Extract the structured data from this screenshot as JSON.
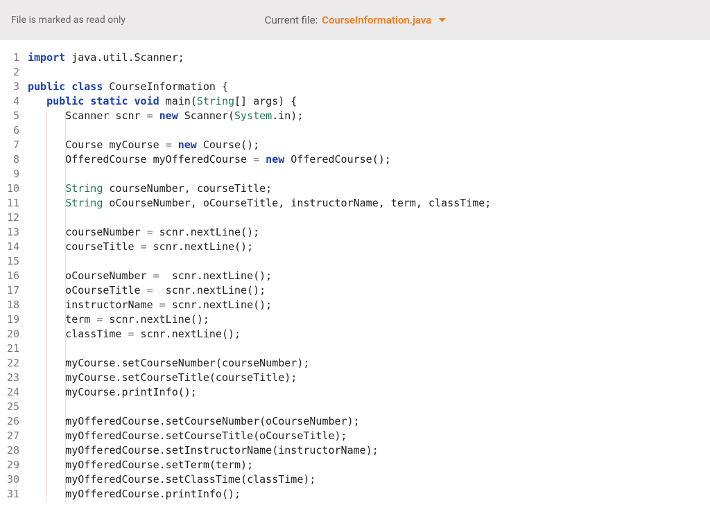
{
  "header": {
    "readonly_message": "File is marked as read only",
    "current_file_label": "Current file:",
    "current_file_name": "CourseInformation.java"
  },
  "editor": {
    "line_count": 31,
    "lines": [
      {
        "n": 1,
        "guides": [],
        "tokens": [
          [
            "kw",
            "import"
          ],
          [
            "txt",
            " java.util.Scanner;"
          ]
        ]
      },
      {
        "n": 2,
        "guides": [],
        "tokens": []
      },
      {
        "n": 3,
        "guides": [],
        "tokens": [
          [
            "kw",
            "public class"
          ],
          [
            "txt",
            " CourseInformation {"
          ]
        ]
      },
      {
        "n": 4,
        "guides": [],
        "tokens": [
          [
            "txt",
            "   "
          ],
          [
            "kw",
            "public static void"
          ],
          [
            "txt",
            " main("
          ],
          [
            "type",
            "String"
          ],
          [
            "txt",
            "[] args) {"
          ]
        ]
      },
      {
        "n": 5,
        "guides": [
          3,
          6
        ],
        "tokens": [
          [
            "txt",
            "      Scanner scnr "
          ],
          [
            "op",
            "="
          ],
          [
            "txt",
            " "
          ],
          [
            "kw",
            "new"
          ],
          [
            "txt",
            " Scanner("
          ],
          [
            "sys",
            "System"
          ],
          [
            "txt",
            ".in);"
          ]
        ]
      },
      {
        "n": 6,
        "guides": [
          3,
          6
        ],
        "tokens": []
      },
      {
        "n": 7,
        "guides": [
          3,
          6
        ],
        "tokens": [
          [
            "txt",
            "      Course myCourse "
          ],
          [
            "op",
            "="
          ],
          [
            "txt",
            " "
          ],
          [
            "kw",
            "new"
          ],
          [
            "txt",
            " Course();"
          ]
        ]
      },
      {
        "n": 8,
        "guides": [
          3,
          6
        ],
        "tokens": [
          [
            "txt",
            "      OfferedCourse myOfferedCourse "
          ],
          [
            "op",
            "="
          ],
          [
            "txt",
            " "
          ],
          [
            "kw",
            "new"
          ],
          [
            "txt",
            " OfferedCourse();"
          ]
        ]
      },
      {
        "n": 9,
        "guides": [
          3,
          6
        ],
        "tokens": []
      },
      {
        "n": 10,
        "guides": [
          3,
          6
        ],
        "tokens": [
          [
            "txt",
            "      "
          ],
          [
            "type",
            "String"
          ],
          [
            "txt",
            " courseNumber, courseTitle;"
          ]
        ]
      },
      {
        "n": 11,
        "guides": [
          3,
          6
        ],
        "tokens": [
          [
            "txt",
            "      "
          ],
          [
            "type",
            "String"
          ],
          [
            "txt",
            " oCourseNumber, oCourseTitle, instructorName, term, classTime;"
          ]
        ]
      },
      {
        "n": 12,
        "guides": [
          3,
          6
        ],
        "tokens": []
      },
      {
        "n": 13,
        "guides": [
          3,
          6
        ],
        "tokens": [
          [
            "txt",
            "      courseNumber "
          ],
          [
            "op",
            "="
          ],
          [
            "txt",
            " scnr.nextLine();"
          ]
        ]
      },
      {
        "n": 14,
        "guides": [
          3,
          6
        ],
        "tokens": [
          [
            "txt",
            "      courseTitle "
          ],
          [
            "op",
            "="
          ],
          [
            "txt",
            " scnr.nextLine();"
          ]
        ]
      },
      {
        "n": 15,
        "guides": [
          3,
          6
        ],
        "tokens": []
      },
      {
        "n": 16,
        "guides": [
          3,
          6
        ],
        "tokens": [
          [
            "txt",
            "      oCourseNumber "
          ],
          [
            "op",
            "="
          ],
          [
            "txt",
            "  scnr.nextLine();"
          ]
        ]
      },
      {
        "n": 17,
        "guides": [
          3,
          6
        ],
        "tokens": [
          [
            "txt",
            "      oCourseTitle "
          ],
          [
            "op",
            "="
          ],
          [
            "txt",
            "  scnr.nextLine();"
          ]
        ]
      },
      {
        "n": 18,
        "guides": [
          3,
          6
        ],
        "tokens": [
          [
            "txt",
            "      instructorName "
          ],
          [
            "op",
            "="
          ],
          [
            "txt",
            " scnr.nextLine();"
          ]
        ]
      },
      {
        "n": 19,
        "guides": [
          3,
          6
        ],
        "tokens": [
          [
            "txt",
            "      term "
          ],
          [
            "op",
            "="
          ],
          [
            "txt",
            " scnr.nextLine();"
          ]
        ]
      },
      {
        "n": 20,
        "guides": [
          3,
          6
        ],
        "tokens": [
          [
            "txt",
            "      classTime "
          ],
          [
            "op",
            "="
          ],
          [
            "txt",
            " scnr.nextLine();"
          ]
        ]
      },
      {
        "n": 21,
        "guides": [
          3,
          6
        ],
        "tokens": []
      },
      {
        "n": 22,
        "guides": [
          3,
          6
        ],
        "tokens": [
          [
            "txt",
            "      myCourse.setCourseNumber(courseNumber);"
          ]
        ]
      },
      {
        "n": 23,
        "guides": [
          3,
          6
        ],
        "tokens": [
          [
            "txt",
            "      myCourse.setCourseTitle(courseTitle);"
          ]
        ]
      },
      {
        "n": 24,
        "guides": [
          3,
          6
        ],
        "tokens": [
          [
            "txt",
            "      myCourse.printInfo();"
          ]
        ]
      },
      {
        "n": 25,
        "guides": [
          3,
          6
        ],
        "tokens": []
      },
      {
        "n": 26,
        "guides": [
          3,
          6
        ],
        "tokens": [
          [
            "txt",
            "      myOfferedCourse.setCourseNumber(oCourseNumber);"
          ]
        ]
      },
      {
        "n": 27,
        "guides": [
          3,
          6
        ],
        "tokens": [
          [
            "txt",
            "      myOfferedCourse.setCourseTitle(oCourseTitle);"
          ]
        ]
      },
      {
        "n": 28,
        "guides": [
          3,
          6
        ],
        "tokens": [
          [
            "txt",
            "      myOfferedCourse.setInstructorName(instructorName);"
          ]
        ]
      },
      {
        "n": 29,
        "guides": [
          3,
          6
        ],
        "tokens": [
          [
            "txt",
            "      myOfferedCourse.setTerm(term);"
          ]
        ]
      },
      {
        "n": 30,
        "guides": [
          3,
          6
        ],
        "tokens": [
          [
            "txt",
            "      myOfferedCourse.setClassTime(classTime);"
          ]
        ]
      },
      {
        "n": 31,
        "guides": [
          3,
          6
        ],
        "tokens": [
          [
            "txt",
            "      myOfferedCourse.printInfo();"
          ]
        ]
      }
    ]
  }
}
